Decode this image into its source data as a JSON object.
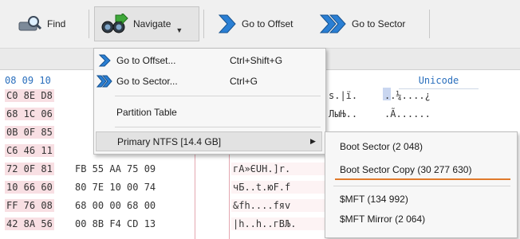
{
  "toolbar": {
    "find_label": "Find",
    "navigate_label": "Navigate",
    "go_offset_label": "Go to Offset",
    "go_sector_label": "Go to Sector"
  },
  "hex_view": {
    "header_hex": "08 09 10",
    "header_unicode": "Unicode",
    "rows": [
      {
        "offset": "C0 8E D8",
        "hex": "",
        "text": "s.|ï.",
        "unicode": "..¼....¿"
      },
      {
        "offset": "68 1C 06",
        "hex": "",
        "text": "ЛыЊ..",
        "unicode": ".Ã......"
      },
      {
        "offset": "0B 0F 85",
        "hex": "",
        "text": "",
        "unicode": ""
      },
      {
        "offset": "C6 46 11",
        "hex": "",
        "text": "",
        "unicode": ""
      },
      {
        "offset": "72 0F 81",
        "hex": "FB 55 AA 75 09",
        "text": "гА»ЄUH.]r.",
        "unicode": ""
      },
      {
        "offset": "10 66 60",
        "hex": "80 7E 10 00 74",
        "text": "чБ..t.юF.f",
        "unicode": ""
      },
      {
        "offset": "FF 76 08",
        "hex": "68 00 00 68 00",
        "text": "&fh....fяv",
        "unicode": ""
      },
      {
        "offset": "42 8A 56",
        "hex": "00 8B F4 CD 13",
        "text": "|h..h..гВЉ.",
        "unicode": "........"
      }
    ]
  },
  "navigate_menu": {
    "items": [
      {
        "label": "Go to Offset...",
        "shortcut": "Ctrl+Shift+G"
      },
      {
        "label": "Go to Sector...",
        "shortcut": "Ctrl+G"
      },
      {
        "label": "Partition Table",
        "shortcut": ""
      },
      {
        "label": "Primary NTFS [14.4 GB]",
        "shortcut": ""
      }
    ]
  },
  "submenu": {
    "items": [
      {
        "label": "Boot Sector (2 048)"
      },
      {
        "label": "Boot Sector Copy (30 277 630)"
      },
      {
        "label": "$MFT (134 992)"
      },
      {
        "label": "$MFT Mirror (2 064)"
      }
    ]
  },
  "colors": {
    "accent_blue": "#2a6fbd",
    "selection_orange": "#e07a2c",
    "highlight_pink": "#f8dfe3"
  }
}
